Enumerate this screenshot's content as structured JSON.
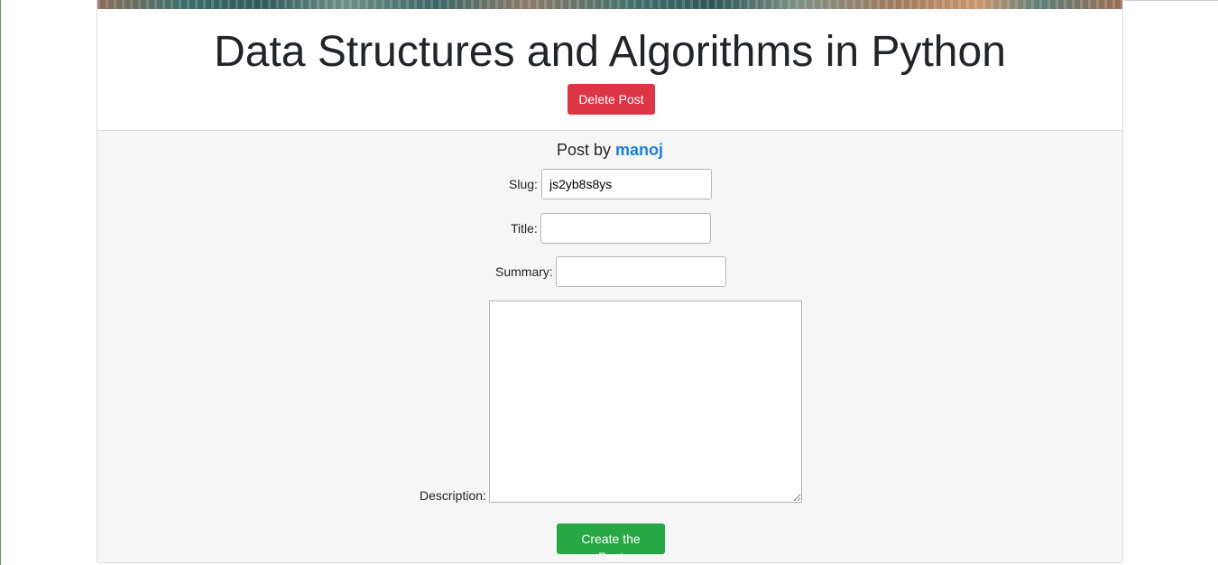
{
  "header": {
    "title": "Data Structures and Algorithms in Python",
    "delete_button": "Delete Post"
  },
  "post": {
    "by_prefix": "Post by",
    "author": "manoj"
  },
  "form": {
    "slug_label": "Slug:",
    "slug_value": "js2yb8s8ys",
    "title_label": "Title:",
    "title_value": "",
    "summary_label": "Summary:",
    "summary_value": "",
    "description_label": "Description:",
    "description_value": "",
    "submit_button": "Create the Post"
  },
  "colors": {
    "danger": "#dc3545",
    "success": "#28a745",
    "link": "#1a7fe0",
    "body_background": "#f6f6f6"
  }
}
